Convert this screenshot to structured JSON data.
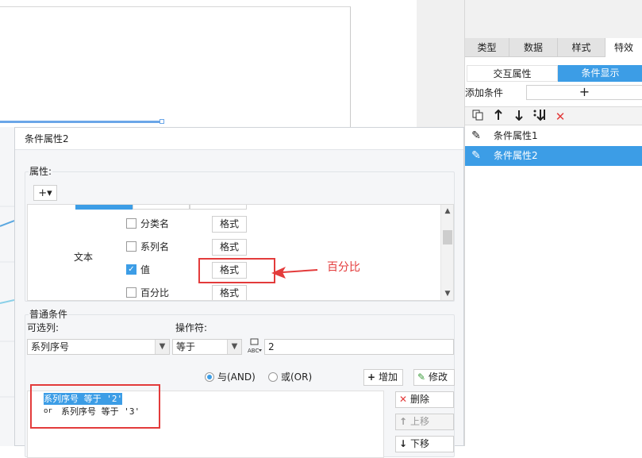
{
  "right_panel": {
    "tabs": [
      {
        "label": "类型",
        "active": false
      },
      {
        "label": "数据",
        "active": false
      },
      {
        "label": "样式",
        "active": false
      },
      {
        "label": "特效",
        "active": true
      }
    ],
    "subtabs": [
      {
        "label": "交互属性",
        "active": false
      },
      {
        "label": "条件显示",
        "active": true
      }
    ],
    "add_condition_label": "添加条件",
    "add_condition_button": "+",
    "toolbar_icons": [
      "copy-icon",
      "move-up-icon",
      "move-down-icon",
      "move-bottom-icon",
      "delete-icon"
    ],
    "conditions": [
      {
        "label": "条件属性1",
        "selected": false
      },
      {
        "label": "条件属性2",
        "selected": true
      }
    ]
  },
  "dialog": {
    "title": "条件属性2",
    "properties_group": {
      "title": "属性:",
      "add_button": "+▾",
      "text_label": "文本",
      "options": [
        {
          "label": "分类名",
          "checked": false,
          "button": "格式"
        },
        {
          "label": "系列名",
          "checked": false,
          "button": "格式"
        },
        {
          "label": "值",
          "checked": true,
          "button": "格式"
        },
        {
          "label": "百分比",
          "checked": false,
          "button": "格式"
        }
      ]
    },
    "conditions_group": {
      "title": "普通条件",
      "column_label": "可选列:",
      "column_value": "系列序号",
      "operator_label": "操作符:",
      "operator_value": "等于",
      "value": "2",
      "and_label": "与(AND)",
      "or_label": "或(OR)",
      "logic_selected": "and",
      "add_button": "增加",
      "modify_button": "修改",
      "delete_button": "删除",
      "move_up_button": "上移",
      "move_down_button": "下移",
      "condition_lines": [
        {
          "text": "系列序号 等于 '2'",
          "prefix": "",
          "selected": true
        },
        {
          "text": "系列序号 等于 '3'",
          "prefix": "or",
          "selected": false
        }
      ]
    }
  },
  "annotation": {
    "text": "百分比",
    "color": "#e33b3b"
  },
  "colors": {
    "accent": "#3c9de6",
    "annotation_red": "#e33b3b"
  }
}
